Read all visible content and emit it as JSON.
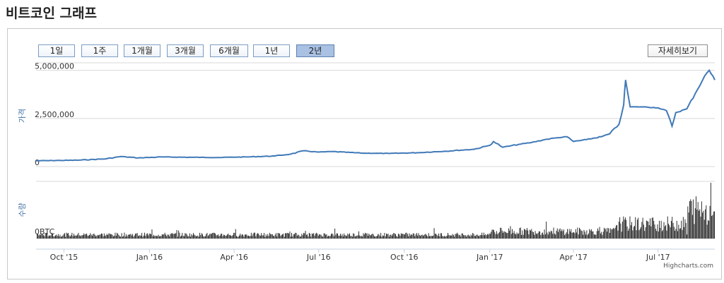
{
  "page": {
    "title": "비트코인 그래프"
  },
  "range_buttons": [
    {
      "label": "1일",
      "active": false
    },
    {
      "label": "1주",
      "active": false
    },
    {
      "label": "1개월",
      "active": false
    },
    {
      "label": "3개월",
      "active": false
    },
    {
      "label": "6개월",
      "active": false
    },
    {
      "label": "1년",
      "active": false
    },
    {
      "label": "2년",
      "active": true
    }
  ],
  "detail_button": {
    "label": "자세히보기"
  },
  "credit": "Highcharts.com",
  "chart_data": [
    {
      "type": "line",
      "ylabel": "가격",
      "ylim": [
        0,
        5500000
      ],
      "yticks": [
        "0",
        "2,500,000",
        "5,000,000"
      ],
      "ytick_values": [
        0,
        2500000,
        5000000
      ],
      "grid": true,
      "line_color": "#4079b8",
      "x": [
        "2015-09-01",
        "2015-10-15",
        "2015-11-15",
        "2015-12-01",
        "2015-12-20",
        "2016-01-15",
        "2016-02-15",
        "2016-03-15",
        "2016-04-15",
        "2016-05-15",
        "2016-06-01",
        "2016-06-15",
        "2016-07-01",
        "2016-07-15",
        "2016-08-15",
        "2016-09-15",
        "2016-10-15",
        "2016-11-15",
        "2016-12-15",
        "2017-01-01",
        "2017-01-05",
        "2017-01-15",
        "2017-02-01",
        "2017-02-15",
        "2017-03-01",
        "2017-03-15",
        "2017-03-25",
        "2017-04-01",
        "2017-04-15",
        "2017-05-01",
        "2017-05-10",
        "2017-05-20",
        "2017-05-25",
        "2017-05-27",
        "2017-06-01",
        "2017-06-15",
        "2017-07-01",
        "2017-07-10",
        "2017-07-16",
        "2017-07-20",
        "2017-08-01",
        "2017-08-10",
        "2017-08-20",
        "2017-08-25",
        "2017-08-31"
      ],
      "y": [
        300000,
        330000,
        400000,
        520000,
        450000,
        500000,
        480000,
        470000,
        500000,
        550000,
        650000,
        820000,
        750000,
        780000,
        700000,
        680000,
        720000,
        800000,
        900000,
        1100000,
        1300000,
        1000000,
        1150000,
        1250000,
        1400000,
        1500000,
        1550000,
        1300000,
        1400000,
        1550000,
        1700000,
        2200000,
        3200000,
        4500000,
        3100000,
        3100000,
        3050000,
        2900000,
        2100000,
        2800000,
        3000000,
        3800000,
        4700000,
        5000000,
        4500000
      ]
    },
    {
      "type": "bar",
      "ylabel": "수량",
      "yticks": [
        "0BTC"
      ],
      "bar_color": "#1a1a1a",
      "x_range": [
        "2015-09-01",
        "2017-08-31"
      ],
      "volume_profile": [
        {
          "from": "2015-09-01",
          "to": "2016-12-31",
          "level": 0.08
        },
        {
          "from": "2017-01-01",
          "to": "2017-05-15",
          "level": 0.15
        },
        {
          "from": "2017-05-15",
          "to": "2017-07-31",
          "level": 0.3
        },
        {
          "from": "2017-08-01",
          "to": "2017-08-31",
          "level": 0.6
        }
      ]
    }
  ],
  "x_axis": {
    "labels": [
      "Oct '15",
      "Jan '16",
      "Apr '16",
      "Jul '16",
      "Oct '16",
      "Jan '17",
      "Apr '17",
      "Jul '17"
    ],
    "dates": [
      "2015-10-01",
      "2016-01-01",
      "2016-04-01",
      "2016-07-01",
      "2016-10-01",
      "2017-01-01",
      "2017-04-01",
      "2017-07-01"
    ]
  }
}
